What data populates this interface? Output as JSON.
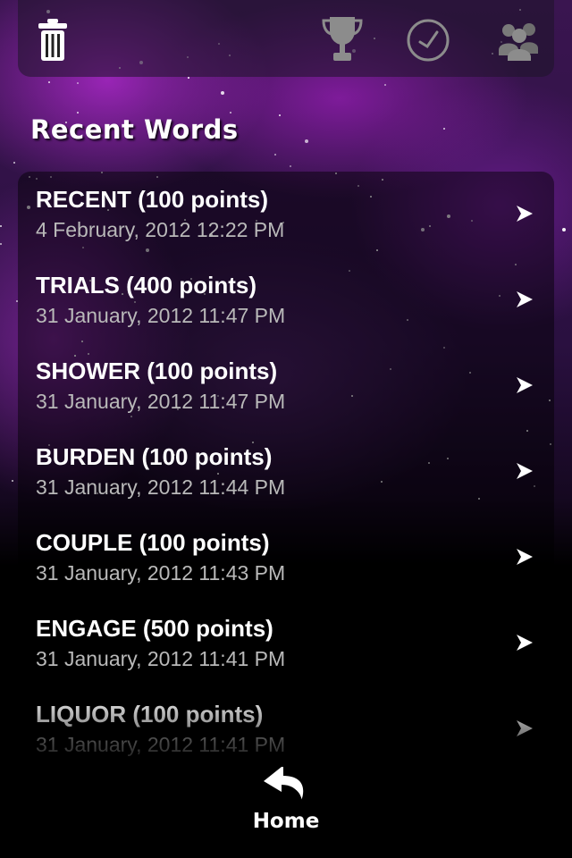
{
  "toolbar": {
    "icons": [
      "trash-icon",
      "trophy-icon",
      "clock-icon",
      "people-icon"
    ]
  },
  "section": {
    "title": "Recent Words"
  },
  "words": [
    {
      "word": "RECENT (100 points)",
      "date": "4 February, 2012 12:22 PM"
    },
    {
      "word": "TRIALS (400 points)",
      "date": "31 January, 2012 11:47 PM"
    },
    {
      "word": "SHOWER (100 points)",
      "date": "31 January, 2012 11:47 PM"
    },
    {
      "word": "BURDEN (100 points)",
      "date": "31 January, 2012 11:44 PM"
    },
    {
      "word": "COUPLE (100 points)",
      "date": "31 January, 2012 11:43 PM"
    },
    {
      "word": "ENGAGE (500 points)",
      "date": "31 January, 2012 11:41 PM"
    },
    {
      "word": "LIQUOR (100 points)",
      "date": "31 January, 2012 11:41 PM"
    }
  ],
  "footer": {
    "home_label": "Home",
    "home_icon": "back-arrow-icon"
  },
  "colors": {
    "text": "#ffffff",
    "date_text": "#b9b9b9",
    "nebula": "#8a2bb0"
  }
}
